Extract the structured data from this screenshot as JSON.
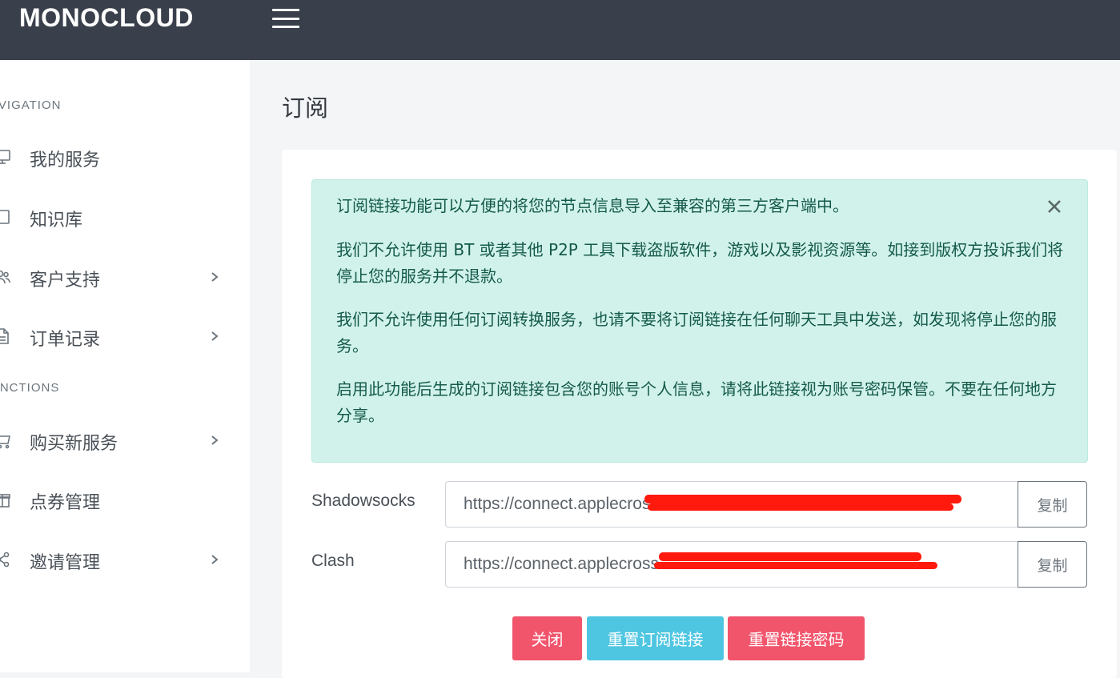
{
  "app": {
    "brand": "MONOCLOUD"
  },
  "sidebar": {
    "sections": [
      {
        "heading": "AVIGATION"
      },
      {
        "heading": "UNCTIONS"
      }
    ],
    "items": [
      {
        "label": "我的服务",
        "icon": "monitor-icon",
        "has_submenu": false
      },
      {
        "label": "知识库",
        "icon": "book-icon",
        "has_submenu": false
      },
      {
        "label": "客户支持",
        "icon": "users-icon",
        "has_submenu": true
      },
      {
        "label": "订单记录",
        "icon": "file-icon",
        "has_submenu": true
      },
      {
        "label": "购买新服务",
        "icon": "cart-icon",
        "has_submenu": true
      },
      {
        "label": "点券管理",
        "icon": "gift-icon",
        "has_submenu": false
      },
      {
        "label": "邀请管理",
        "icon": "share-icon",
        "has_submenu": true
      }
    ]
  },
  "main": {
    "title": "订阅",
    "alert": {
      "paragraphs": [
        "订阅链接功能可以方便的将您的节点信息导入至兼容的第三方客户端中。",
        "我们不允许使用 BT 或者其他 P2P 工具下载盗版软件，游戏以及影视资源等。如接到版权方投诉我们将停止您的服务并不退款。",
        "我们不允许使用任何订阅转换服务，也请不要将订阅链接在任何聊天工具中发送，如发现将停止您的服务。",
        "启用此功能后生成的订阅链接包含您的账号个人信息，请将此链接视为账号密码保管。不要在任何地方分享。"
      ]
    },
    "links": [
      {
        "label": "Shadowsocks",
        "value": "https://connect.applecros",
        "copy_label": "复制"
      },
      {
        "label": "Clash",
        "value": "https://connect.applecross",
        "copy_label": "复制"
      }
    ],
    "buttons": {
      "close": "关闭",
      "reset_link": "重置订阅链接",
      "reset_password": "重置链接密码"
    }
  },
  "colors": {
    "topbar": "#3a404b",
    "alert_bg": "#d1f2eb",
    "danger": "#f1556c",
    "info": "#4fc6e1",
    "redaction": "#ff1a0d"
  }
}
